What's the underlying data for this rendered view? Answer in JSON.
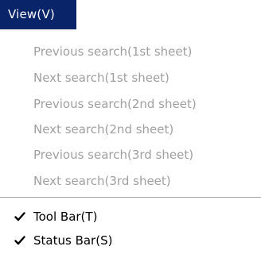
{
  "menu": {
    "title": "View(V)",
    "disabled_items": [
      "Previous search(1st sheet)",
      "Next search(1st sheet)",
      "Previous search(2nd sheet)",
      "Next search(2nd sheet)",
      "Previous search(3rd sheet)",
      "Next search(3rd sheet)"
    ],
    "checked_items": [
      {
        "label": "Tool Bar(T)",
        "checked": true,
        "icon": "checkmark-icon"
      },
      {
        "label": "Status Bar(S)",
        "checked": true,
        "icon": "checkmark-icon"
      }
    ]
  },
  "colors": {
    "title_bg": "#0a246a",
    "title_fg": "#ffffff",
    "disabled_text": "#a0a0a0",
    "enabled_text": "#000000"
  }
}
